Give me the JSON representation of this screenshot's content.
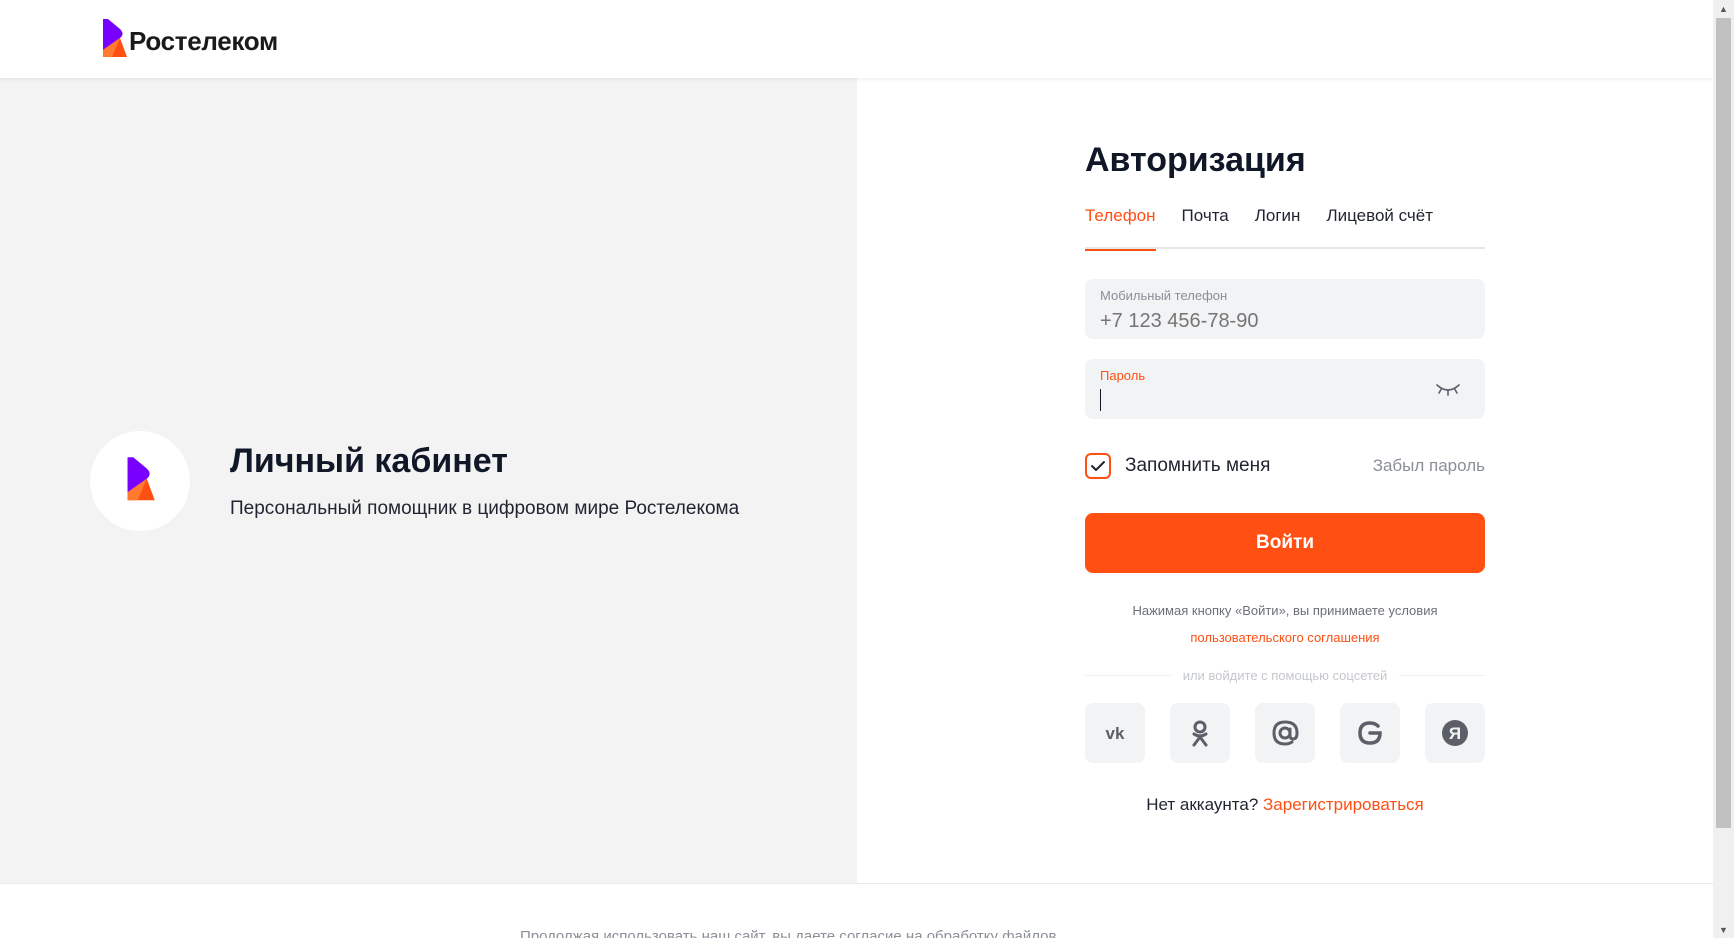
{
  "header": {
    "brand": "Ростелеком"
  },
  "promo": {
    "title": "Личный кабинет",
    "subtitle": "Персональный помощник в цифровом мире Ростелекома"
  },
  "auth": {
    "title": "Авторизация",
    "tabs": [
      {
        "label": "Телефон",
        "active": true
      },
      {
        "label": "Почта",
        "active": false
      },
      {
        "label": "Логин",
        "active": false
      },
      {
        "label": "Лицевой счёт",
        "active": false
      }
    ],
    "phone": {
      "label": "Мобильный телефон",
      "placeholder": "+7 123 456-78-90",
      "value": ""
    },
    "password": {
      "label": "Пароль",
      "value": ""
    },
    "remember": {
      "label": "Запомнить меня",
      "checked": true
    },
    "forgot": "Забыл пароль",
    "submit": "Войти",
    "terms": {
      "text": "Нажимая кнопку «Войти», вы принимаете условия",
      "link": "пользовательского соглашения"
    },
    "social_divider": "или войдите с помощью соцсетей",
    "socials": [
      "vk-icon",
      "ok-icon",
      "mail-icon",
      "google-icon",
      "yandex-icon"
    ],
    "register": {
      "text": "Нет аккаунта?",
      "link": "Зарегистрироваться"
    }
  },
  "footer": {
    "text": "Продолжая использовать наш сайт, вы даете согласие на обработку файлов"
  },
  "colors": {
    "accent": "#ff4f12",
    "brand_purple": "#7700ff",
    "panel_bg": "#f3f3f3",
    "field_bg": "#f2f3f5"
  }
}
